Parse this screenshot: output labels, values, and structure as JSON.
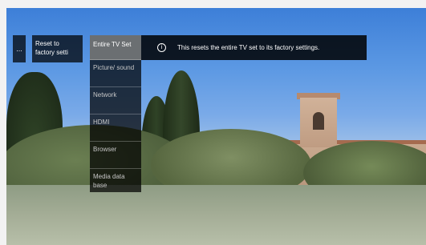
{
  "breadcrumb": {
    "back_label": "...",
    "parent_label": "Reset to factory setti"
  },
  "menu": {
    "items": [
      {
        "label": "Entire TV Set"
      },
      {
        "label": "Picture/ sound"
      },
      {
        "label": "Network"
      },
      {
        "label": "HDMI"
      },
      {
        "label": "Browser"
      },
      {
        "label": "Media data base"
      }
    ]
  },
  "info": {
    "icon": "info-icon",
    "text": "This resets the entire TV set to its factory settings."
  }
}
